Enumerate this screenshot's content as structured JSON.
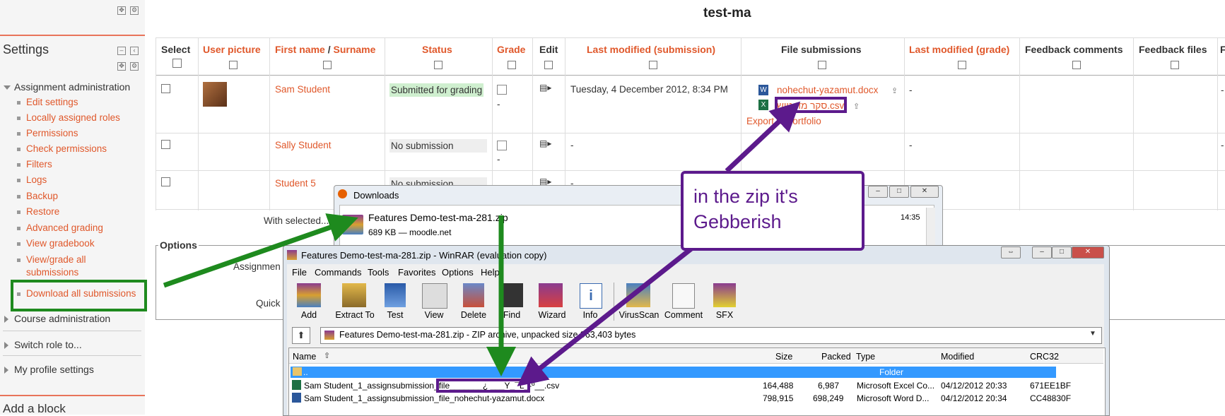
{
  "page": {
    "title": "test-ma"
  },
  "sidebar": {
    "settings_title": "Settings",
    "assignment_admin": "Assignment administration",
    "items": [
      "Edit settings",
      "Locally assigned roles",
      "Permissions",
      "Check permissions",
      "Filters",
      "Logs",
      "Backup",
      "Restore",
      "Advanced grading",
      "View gradebook",
      "View/grade all",
      "submissions",
      "Download all submissions"
    ],
    "course_admin": "Course administration",
    "switch_role": "Switch role to...",
    "profile": "My profile settings",
    "add_block": "Add a block"
  },
  "table": {
    "headers": {
      "select": "Select",
      "user_picture": "User picture",
      "first_name": "First name",
      "slash": "/",
      "surname": "Surname",
      "status": "Status",
      "grade": "Grade",
      "edit": "Edit",
      "last_modified_submission": "Last modified (submission)",
      "file_submissions": "File submissions",
      "last_modified_grade": "Last modified (grade)",
      "feedback_comments": "Feedback comments",
      "feedback_files": "Feedback files",
      "extra": "F"
    },
    "rows": [
      {
        "name": "Sam Student",
        "status": "Submitted for grading",
        "grade": "-",
        "modified": "Tuesday, 4 December 2012, 8:34 PM",
        "file1": "nohechut-yazamut.docx",
        "file2": "סקר מד-טוש.csv",
        "export": "Export to portfolio",
        "mod_grade": "-",
        "dash": "-"
      },
      {
        "name": "Sally Student",
        "status": "No submission",
        "grade": "-",
        "modified": "-",
        "mod_grade": "-",
        "dash": "-"
      },
      {
        "name": "Student 5",
        "status": "No submission",
        "modified": "-"
      }
    ]
  },
  "with_selected": "With selected...",
  "options": {
    "title": "Options",
    "assignments": "Assignmen",
    "quick": "Quick"
  },
  "downloads": {
    "title": "Downloads",
    "file": "Features Demo-test-ma-281.zip",
    "meta": "689 KB — moodle.net",
    "time": "14:35"
  },
  "winrar": {
    "title": "Features Demo-test-ma-281.zip - WinRAR (evaluation copy)",
    "menu": [
      "File",
      "Commands",
      "Tools",
      "Favorites",
      "Options",
      "Help"
    ],
    "tools": [
      "Add",
      "Extract To",
      "Test",
      "View",
      "Delete",
      "Find",
      "Wizard",
      "Info",
      "VirusScan",
      "Comment",
      "SFX"
    ],
    "path": "Features Demo-test-ma-281.zip - ZIP archive, unpacked size 963,403 bytes",
    "columns": [
      "Name",
      "Size",
      "Packed",
      "Type",
      "Modified",
      "CRC32"
    ],
    "rows": [
      {
        "name": "..",
        "size": "",
        "packed": "",
        "type": "Folder",
        "modified": "",
        "crc": ""
      },
      {
        "name": "Sam Student_1_assignsubmission_file_______¿ ___Y_¯L_-º__.csv",
        "size": "164,488",
        "packed": "6,987",
        "type": "Microsoft Excel Co...",
        "modified": "04/12/2012 20:33",
        "crc": "671EE1BF"
      },
      {
        "name": "Sam Student_1_assignsubmission_file_nohechut-yazamut.docx",
        "size": "798,915",
        "packed": "698,249",
        "type": "Microsoft Word D...",
        "modified": "04/12/2012 20:34",
        "crc": "CC48830F"
      }
    ]
  },
  "callout": {
    "text": "in the zip it's Gebberish"
  },
  "colors": {
    "link": "#e0582b",
    "callout": "#5c1a8c",
    "arrow": "#1e8a1e",
    "highlight": "#3399ff"
  }
}
